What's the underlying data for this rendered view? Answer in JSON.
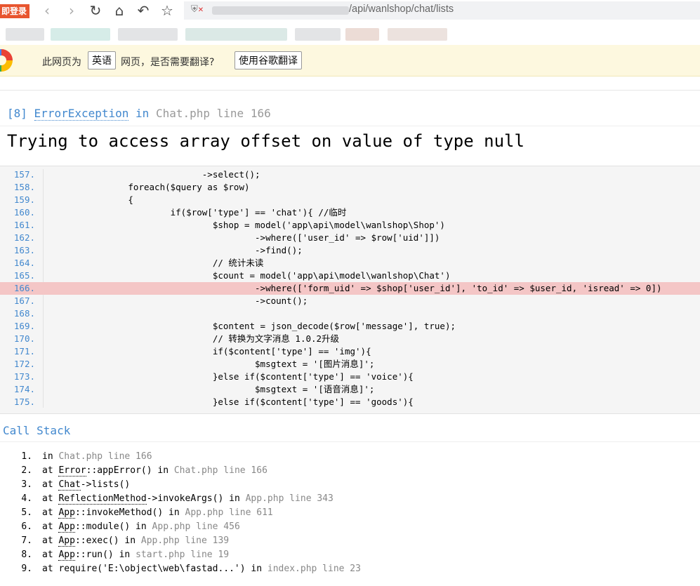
{
  "browser": {
    "login_badge": "即登录",
    "url_path": "/api/wanlshop/chat/lists"
  },
  "translate_bar": {
    "text_prefix": "此网页为",
    "language_button": "英语",
    "text_suffix": "网页，是否需要翻译?",
    "translate_button": "使用谷歌翻译"
  },
  "error": {
    "code": "[8]",
    "type": "ErrorException",
    "in_word": "in",
    "location": "Chat.php line 166",
    "message": "Trying to access array offset on value of type null"
  },
  "code_lines": [
    {
      "no": "157.",
      "text": "                              ->select();"
    },
    {
      "no": "158.",
      "text": "                foreach($query as $row)"
    },
    {
      "no": "159.",
      "text": "                {"
    },
    {
      "no": "160.",
      "text": "                        if($row['type'] == 'chat'){ //临时"
    },
    {
      "no": "161.",
      "text": "                                $shop = model('app\\api\\model\\wanlshop\\Shop')"
    },
    {
      "no": "162.",
      "text": "                                        ->where(['user_id' => $row['uid']])"
    },
    {
      "no": "163.",
      "text": "                                        ->find();"
    },
    {
      "no": "164.",
      "text": "                                // 统计未读"
    },
    {
      "no": "165.",
      "text": "                                $count = model('app\\api\\model\\wanlshop\\Chat')"
    },
    {
      "no": "166.",
      "text": "                                        ->where(['form_uid' => $shop['user_id'], 'to_id' => $user_id, 'isread' => 0])"
    },
    {
      "no": "167.",
      "text": "                                        ->count();"
    },
    {
      "no": "168.",
      "text": ""
    },
    {
      "no": "169.",
      "text": "                                $content = json_decode($row['message'], true);"
    },
    {
      "no": "170.",
      "text": "                                // 转换为文字消息 1.0.2升级"
    },
    {
      "no": "171.",
      "text": "                                if($content['type'] == 'img'){"
    },
    {
      "no": "172.",
      "text": "                                        $msgtext = '[图片消息]';"
    },
    {
      "no": "173.",
      "text": "                                }else if($content['type'] == 'voice'){"
    },
    {
      "no": "174.",
      "text": "                                        $msgtext = '[语音消息]';"
    },
    {
      "no": "175.",
      "text": "                                }else if($content['type'] == 'goods'){"
    }
  ],
  "highlight_line": "166.",
  "call_stack": {
    "title": "Call Stack",
    "items": [
      {
        "n": "1.",
        "pre": "in ",
        "u": "",
        "mid": "",
        "post": "",
        "g": "Chat.php line 166"
      },
      {
        "n": "2.",
        "pre": "at ",
        "u": "Error",
        "mid": "::appError() in ",
        "post": "",
        "g": "Chat.php line 166"
      },
      {
        "n": "3.",
        "pre": "at ",
        "u": "Chat",
        "mid": "->lists()",
        "post": "",
        "g": ""
      },
      {
        "n": "4.",
        "pre": "at ",
        "u": "ReflectionMethod",
        "mid": "->invokeArgs() in ",
        "post": "",
        "g": "App.php line 343"
      },
      {
        "n": "5.",
        "pre": "at ",
        "u": "App",
        "mid": "::invokeMethod() in ",
        "post": "",
        "g": "App.php line 611"
      },
      {
        "n": "6.",
        "pre": "at ",
        "u": "App",
        "mid": "::module() in ",
        "post": "",
        "g": "App.php line 456"
      },
      {
        "n": "7.",
        "pre": "at ",
        "u": "App",
        "mid": "::exec() in ",
        "post": "",
        "g": "App.php line 139"
      },
      {
        "n": "8.",
        "pre": "at ",
        "u": "App",
        "mid": "::run() in ",
        "post": "",
        "g": "start.php line 19"
      },
      {
        "n": "9.",
        "pre": "at require(",
        "u": "",
        "mid": "",
        "post": "'E:\\object\\web\\fastad...') in ",
        "g": "index.php line 23"
      }
    ]
  }
}
